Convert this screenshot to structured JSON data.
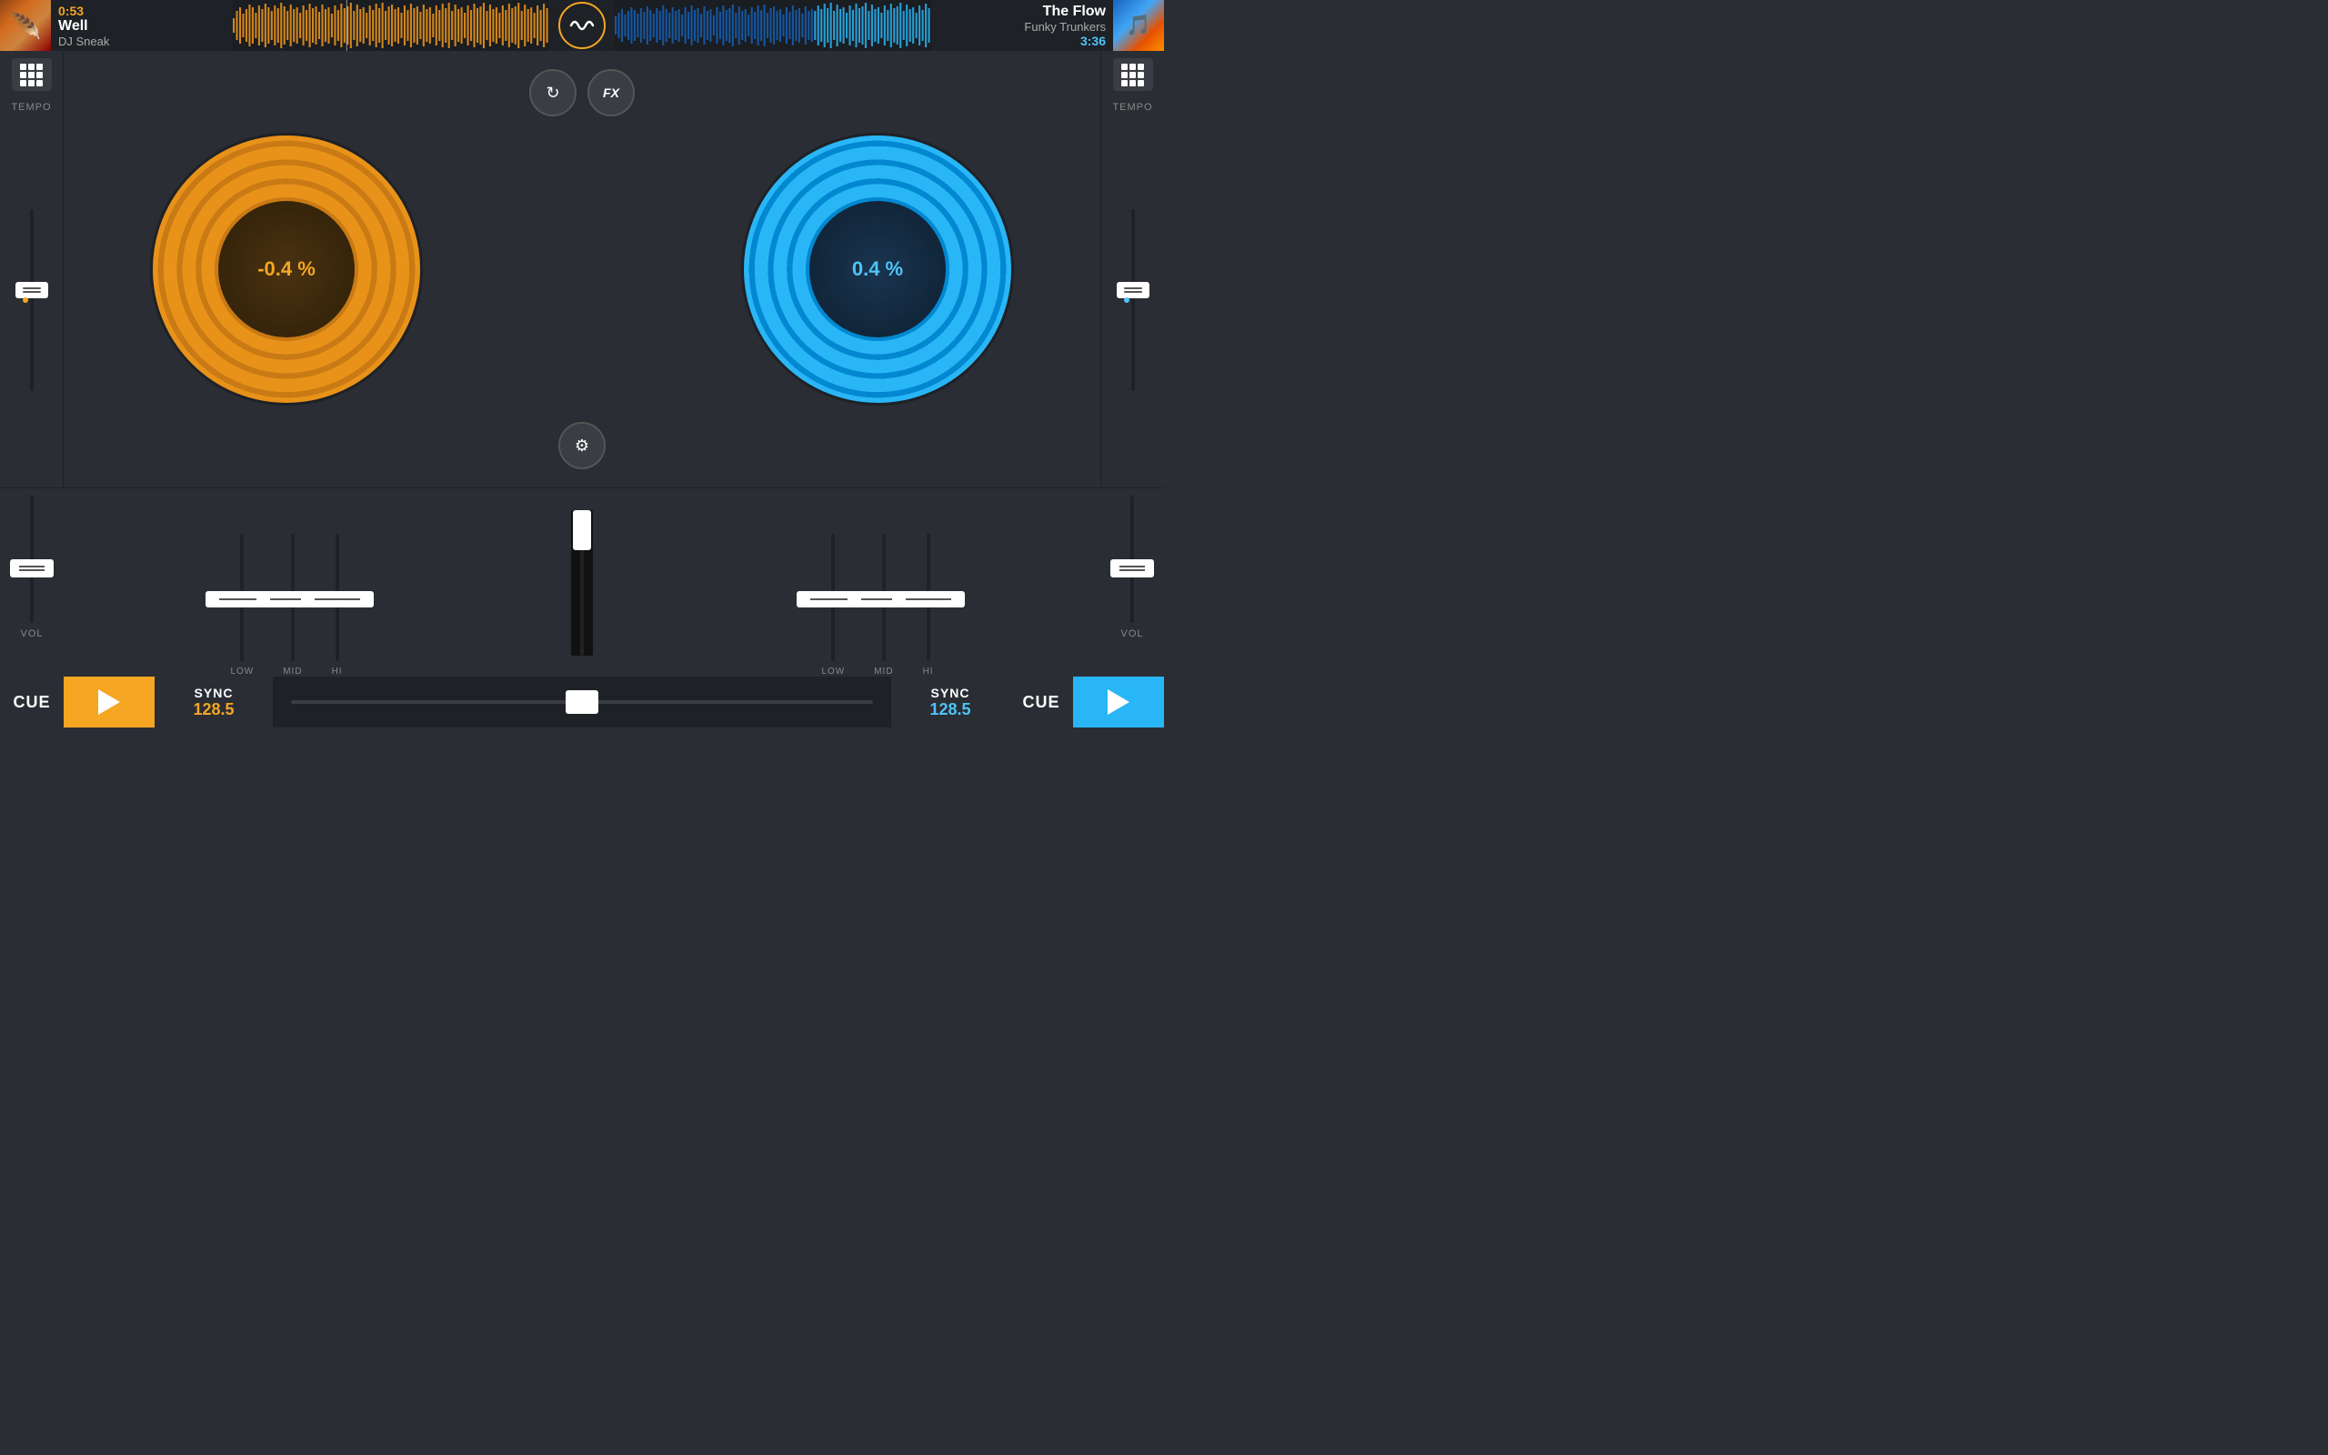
{
  "header": {
    "left": {
      "time": "0:53",
      "title": "Well",
      "artist": "DJ Sneak"
    },
    "right": {
      "title": "The Flow",
      "artist": "Funky Trunkers",
      "time": "3:36"
    },
    "logo_label": "~"
  },
  "deck_left": {
    "tempo_percent": "-0.4 %",
    "tempo_label": "TEMPO"
  },
  "deck_right": {
    "tempo_percent": "0.4 %",
    "tempo_label": "TEMPO"
  },
  "center": {
    "fx_label": "FX"
  },
  "mixer": {
    "left": {
      "vol_label": "VOL",
      "low_label": "LOW",
      "mid_label": "MID",
      "hi_label": "HI"
    },
    "right": {
      "vol_label": "VOL",
      "low_label": "LOW",
      "mid_label": "MID",
      "hi_label": "HI"
    }
  },
  "bottom": {
    "left": {
      "cue_label": "CUE",
      "sync_label": "SYNC",
      "sync_bpm": "128.5"
    },
    "right": {
      "sync_label": "SYNC",
      "sync_bpm": "128.5",
      "cue_label": "CUE"
    }
  },
  "colors": {
    "left_accent": "#f5a623",
    "right_accent": "#29b6f6",
    "bg": "#2a2d33",
    "dark_bg": "#1e2126"
  }
}
